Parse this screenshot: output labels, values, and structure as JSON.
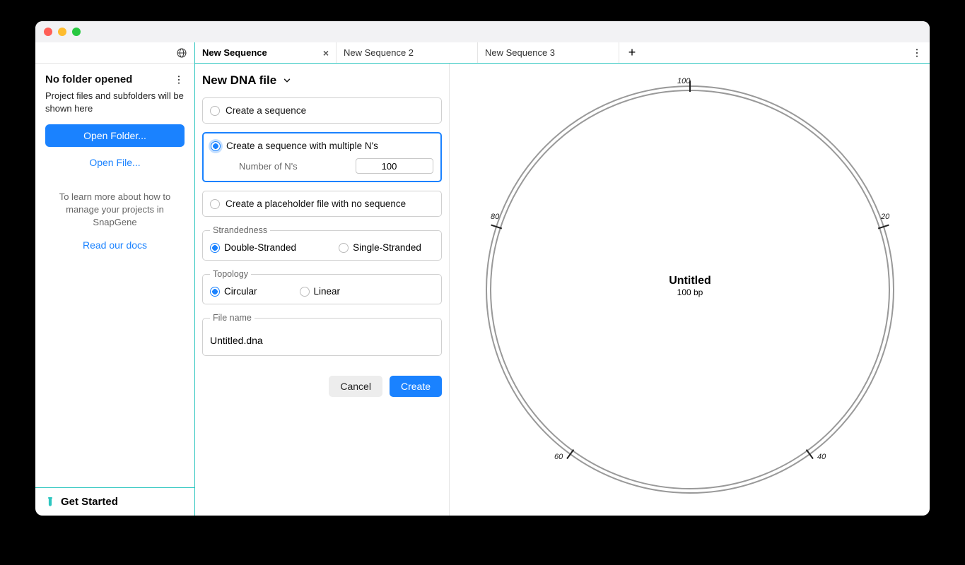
{
  "sidebar": {
    "title": "No folder opened",
    "description": "Project files and subfolders will be shown here",
    "open_folder_label": "Open Folder...",
    "open_file_label": "Open File...",
    "help_text": "To learn more about how to manage your projects in SnapGene",
    "docs_link": "Read our docs",
    "get_started": "Get Started"
  },
  "tabs": [
    {
      "label": "New Sequence",
      "active": true
    },
    {
      "label": "New Sequence 2",
      "active": false
    },
    {
      "label": "New Sequence 3",
      "active": false
    }
  ],
  "form": {
    "page_title": "New DNA file",
    "options": {
      "create_sequence": "Create a sequence",
      "create_with_n": "Create a sequence with multiple N's",
      "n_label": "Number of N's",
      "n_value": "100",
      "create_placeholder": "Create a placeholder file with no sequence"
    },
    "strandedness": {
      "legend": "Strandedness",
      "double": "Double-Stranded",
      "single": "Single-Stranded",
      "selected": "double"
    },
    "topology": {
      "legend": "Topology",
      "circular": "Circular",
      "linear": "Linear",
      "selected": "circular"
    },
    "file_name": {
      "legend": "File name",
      "value": "Untitled.dna"
    },
    "cancel_label": "Cancel",
    "create_label": "Create"
  },
  "viz": {
    "title": "Untitled",
    "subtitle": "100 bp",
    "ticks": [
      "100",
      "20",
      "40",
      "60",
      "80"
    ]
  }
}
